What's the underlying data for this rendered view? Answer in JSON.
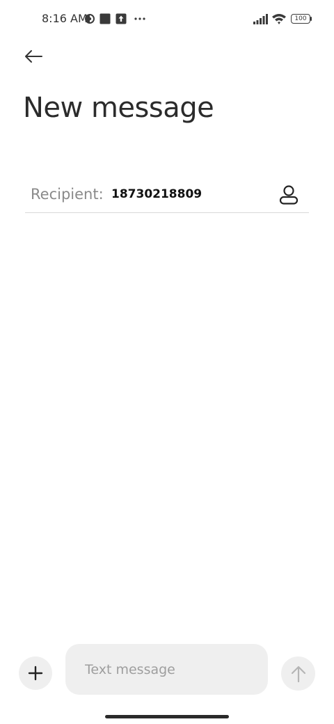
{
  "status_bar": {
    "time": "8:16 AM",
    "left_icons": [
      "vpn-half-circle-icon",
      "square-notification-icon",
      "upload-notification-icon",
      "more-dots-icon"
    ],
    "battery": "100",
    "right_icons": [
      "signal-icon",
      "wifi-icon",
      "battery-icon"
    ]
  },
  "header": {
    "back_icon": "arrow-left-icon",
    "title": "New message"
  },
  "recipient": {
    "label": "Recipient:",
    "value": "18730218809",
    "contacts_icon": "person-icon"
  },
  "composer": {
    "add_icon": "plus-icon",
    "placeholder": "Text message",
    "send_icon": "arrow-up-icon"
  },
  "colors": {
    "background": "#ffffff",
    "field_bg": "#efefef",
    "divider": "#d9d9d9",
    "muted_text": "#8a8a8a"
  }
}
